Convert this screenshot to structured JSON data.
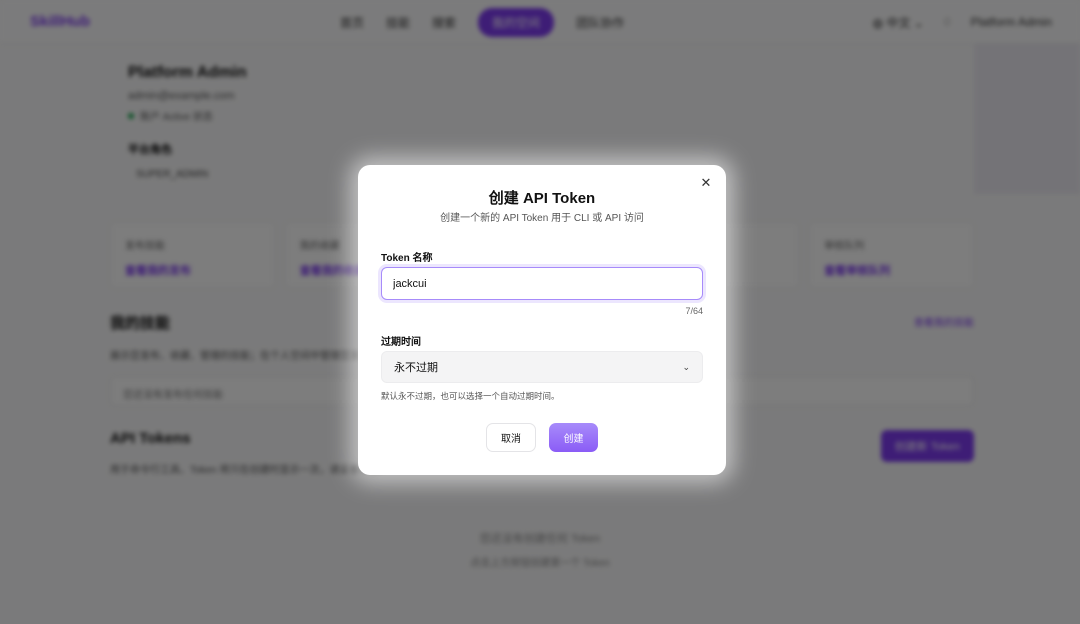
{
  "background": {
    "logo": "SkillHub",
    "nav": [
      "首页",
      "技能",
      "搜索",
      "我的空间",
      "团队协作"
    ],
    "user_menu": {
      "language": "中文",
      "user_name": "Platform Admin"
    },
    "profile": {
      "name": "Platform Admin",
      "email": "admin@example.com",
      "status": "账户 Active 状态",
      "role_label": "平台角色",
      "role": "SUPER_ADMIN"
    },
    "stats": [
      {
        "label": "发布技能",
        "value": "查看我的发布"
      },
      {
        "label": "我的收藏",
        "value": "查看我的收藏"
      },
      {
        "label": "",
        "value": ""
      },
      {
        "label": "",
        "value": ""
      },
      {
        "label": "审核队列",
        "value": "查看审核队列"
      }
    ],
    "section_skills": {
      "title": "我的技能",
      "link": "查看我的技能",
      "desc": "展示您发布、收藏、管理的技能；在个人空间中管理您发布和收藏的所有技能。",
      "box": "您还没有发布任何技能"
    },
    "section_tokens": {
      "title": "API Tokens",
      "button": "创建新 Token",
      "desc": "用于命令行工具、Token 将只在创建时显示一次，请妥善保管。"
    },
    "empty": {
      "line1": "您还没有创建任何 Token",
      "line2": "点击上方按钮创建第一个 Token"
    }
  },
  "modal": {
    "title": "创建 API Token",
    "subtitle": "创建一个新的 API Token 用于 CLI 或 API 访问",
    "name_label": "Token 名称",
    "name_value": "jackcui",
    "counter": "7/64",
    "expiry_label": "过期时间",
    "expiry_value": "永不过期",
    "hint": "默认永不过期，也可以选择一个自动过期时间。",
    "cancel": "取消",
    "create": "创建"
  }
}
